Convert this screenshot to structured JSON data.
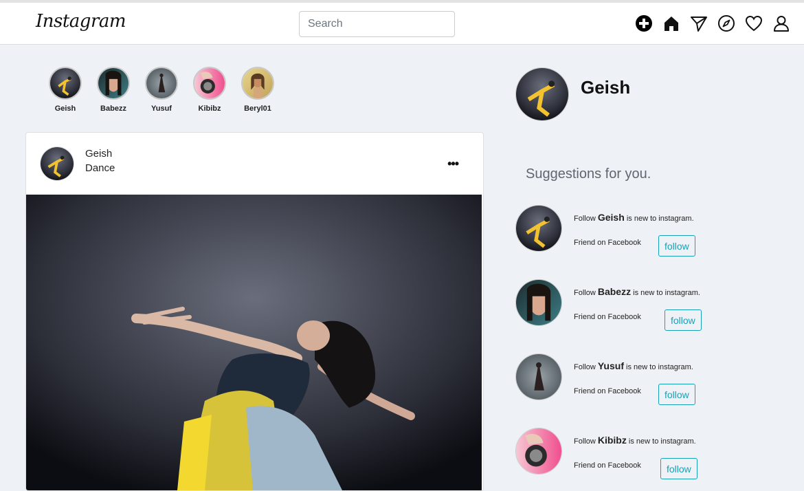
{
  "header": {
    "logo": "Instagram",
    "search_placeholder": "Search",
    "icons": [
      "plus-circle-icon",
      "home-icon",
      "send-icon",
      "explore-compass-icon",
      "heart-icon",
      "user-icon"
    ]
  },
  "stories": [
    {
      "name": "Geish"
    },
    {
      "name": "Babezz"
    },
    {
      "name": "Yusuf"
    },
    {
      "name": "Kibibz"
    },
    {
      "name": "Beryl01"
    }
  ],
  "post": {
    "user": "Geish",
    "caption": "Dance",
    "more": "•••"
  },
  "profile": {
    "name": "Geish"
  },
  "suggestions": {
    "title": "Suggestions for you.",
    "items": [
      {
        "prefix": "Follow",
        "name": "Geish",
        "suffix": "is new to instagram.",
        "sub": "Friend on Facebook",
        "button": "follow"
      },
      {
        "prefix": "Follow",
        "name": "Babezz",
        "suffix": "is new to instagram.",
        "sub": "Friend on Facebook",
        "button": "follow"
      },
      {
        "prefix": "Follow",
        "name": "Yusuf",
        "suffix": "is new to instagram.",
        "sub": "Friend on Facebook",
        "button": "follow"
      },
      {
        "prefix": "Follow",
        "name": "Kibibz",
        "suffix": "is new to instagram.",
        "sub": "Friend on Facebook",
        "button": "follow"
      }
    ]
  },
  "colors": {
    "accent": "#17a2b8",
    "background": "#eef1f5"
  }
}
